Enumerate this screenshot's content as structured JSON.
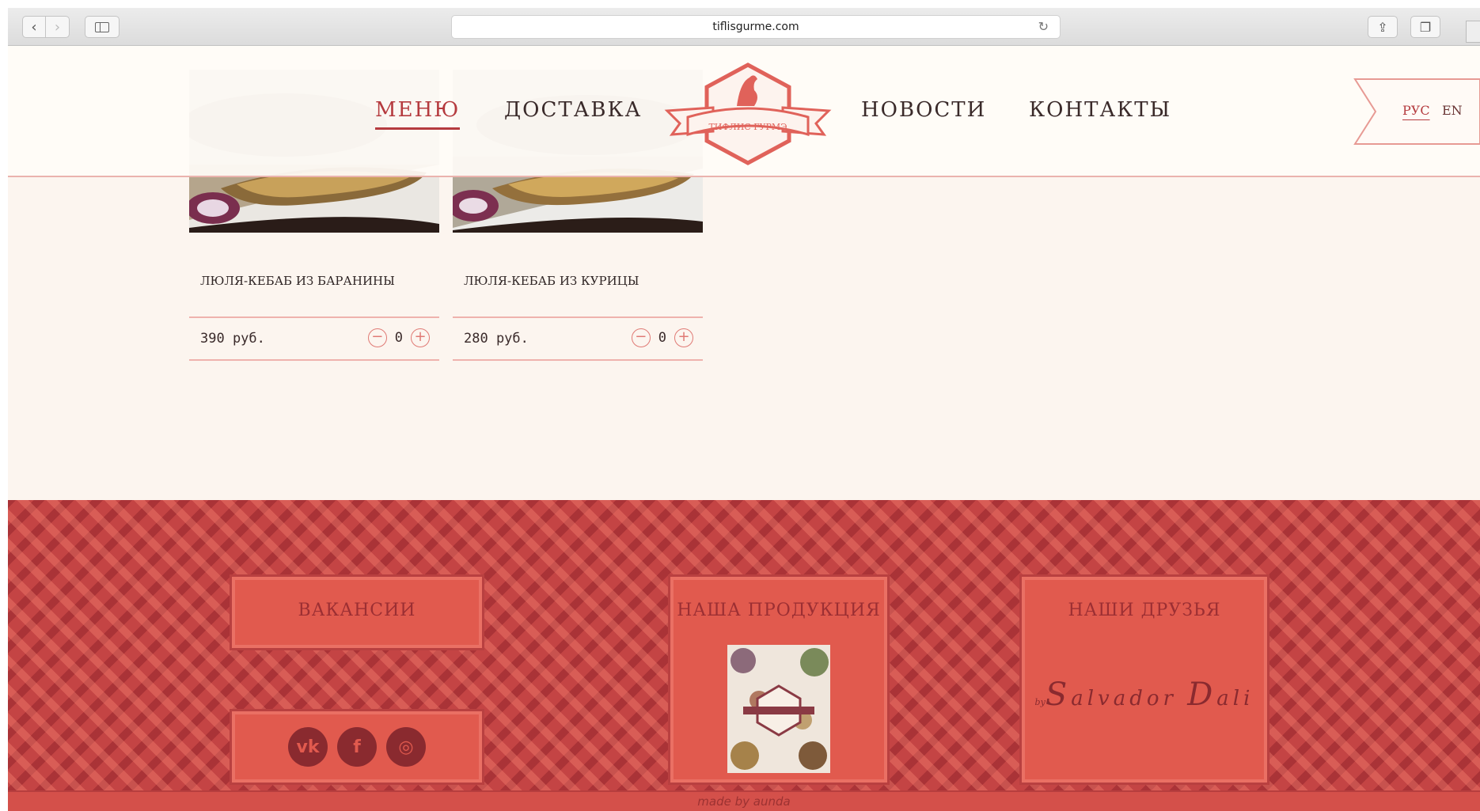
{
  "browser": {
    "url": "tiflisgurme.com",
    "back_icon": "chevron-left-icon",
    "forward_icon": "chevron-right-icon"
  },
  "header": {
    "nav": {
      "menu": "МЕНЮ",
      "delivery": "ДОСТАВКА",
      "news": "НОВОСТИ",
      "contacts": "КОНТАКТЫ"
    },
    "logo_text": "ТИФЛИС ГУРМЭ",
    "lang_ru": "РУС",
    "lang_en": "EN"
  },
  "products": [
    {
      "name": "ЛЮЛЯ-КЕБАБ ИЗ БАРАНИНЫ",
      "price": "390 руб.",
      "qty": "0"
    },
    {
      "name": "ЛЮЛЯ-КЕБАБ ИЗ КУРИЦЫ",
      "price": "280 руб.",
      "qty": "0"
    }
  ],
  "footer": {
    "vacancies": "ВАКАНСИИ",
    "our_products": "НАША ПРОДУКЦИЯ",
    "our_friends": "НАШИ ДРУЗЬЯ",
    "friend_small": "by",
    "friend_s": "S",
    "friend_name1": "alvador",
    "friend_d": "D",
    "friend_name2": "ali",
    "made_by": "made by aunda"
  },
  "social": {
    "vk": "vk",
    "fb": "f",
    "ig": "◎"
  },
  "colors": {
    "accent": "#b53b3f",
    "footer": "#c44444",
    "box": "#e15a4e"
  }
}
